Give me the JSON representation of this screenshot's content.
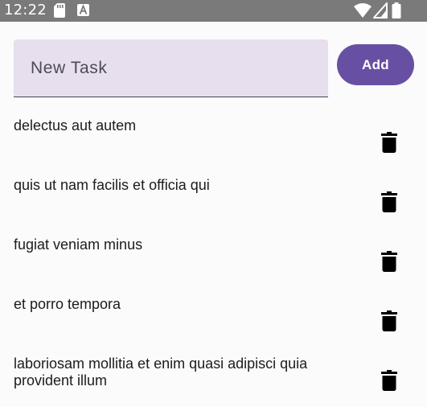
{
  "status_bar": {
    "time": "12:22",
    "icons": [
      "sd-card-icon",
      "a-notification-icon",
      "wifi-icon",
      "signal-icon",
      "battery-icon"
    ]
  },
  "new_task": {
    "placeholder": "New Task",
    "value": "",
    "add_label": "Add"
  },
  "tasks": [
    {
      "text": "delectus aut autem"
    },
    {
      "text": "quis ut nam facilis et officia qui"
    },
    {
      "text": "fugiat veniam minus"
    },
    {
      "text": "et porro tempora"
    },
    {
      "text": "laboriosam mollitia et enim quasi adipisci quia provident illum"
    }
  ],
  "colors": {
    "accent": "#6750a4",
    "input_bg": "#e7dfed",
    "status_bar_bg": "#7a7a7a",
    "background": "#fbfbfb"
  }
}
